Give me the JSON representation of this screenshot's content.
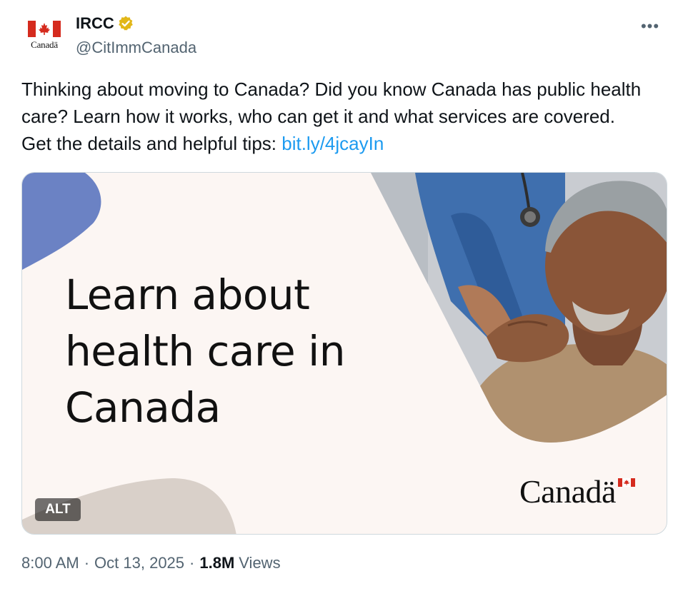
{
  "author": {
    "display_name": "IRCC",
    "handle": "@CitImmCanada",
    "avatar_wordmark": "Canadä",
    "verified_badge_color": "#e2b719"
  },
  "more_icon": "more-horizontal-icon",
  "tweet": {
    "text": "Thinking about moving to Canada? Did you know Canada has public health care? Learn how it works, who can get it and what services are covered. Get the details and helpful tips: ",
    "link": "bit.ly/4jcayIn",
    "link_color": "#1d9bf0"
  },
  "media": {
    "headline_lines": [
      "Learn about",
      "health care in",
      "Canada"
    ],
    "wordmark": "Canadä",
    "alt_label": "ALT",
    "accent_color": "#6b82c4"
  },
  "meta": {
    "time": "8:00 AM",
    "separator": "·",
    "date": "Oct 13, 2025",
    "views_count": "1.8M",
    "views_label": "Views"
  }
}
